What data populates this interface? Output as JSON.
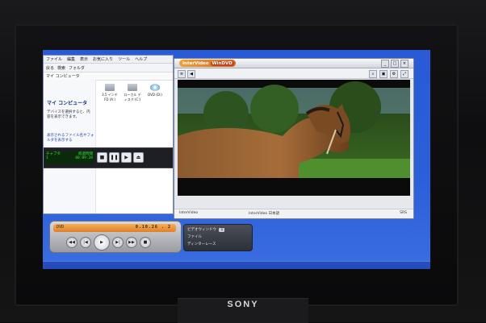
{
  "explorer": {
    "menu": [
      "ファイル",
      "編集",
      "表示",
      "お気に入り",
      "ツール",
      "ヘルプ"
    ],
    "toolbar": [
      "戻る",
      "検索",
      "フォルダ"
    ],
    "address": "マイ コンピュータ",
    "title": "マイ コンピュータ",
    "description": "デバイスを選択すると、内容を表示できます。",
    "link": "表示されるファイル名やフォルダを表示する",
    "drives": [
      {
        "label": "3.5 インチ FD (A:)",
        "kind": "floppy"
      },
      {
        "label": "ローカル ディスク (C:)",
        "kind": "disk"
      },
      {
        "label": "DVD (D:)",
        "kind": "dvd"
      }
    ]
  },
  "status": {
    "lcd_rows": [
      [
        "チャプタ",
        "経過時間"
      ],
      [
        "1",
        "00:09:28"
      ]
    ]
  },
  "windvd": {
    "logo_prefix": "InterVideo",
    "logo_product": "WinDVD",
    "status_left": "InterVideo",
    "status_mid": "InterVideo 日本語",
    "status_right": "SRS"
  },
  "player": {
    "mode": "DVD",
    "time": "0.10.26 . 2"
  },
  "panel": {
    "row1_label": "ビデオウィンドウ",
    "row1_value": "1",
    "row2_label": "ファイル",
    "row3_label": "ディンターレース"
  },
  "tv": {
    "brand": "SONY"
  },
  "colors": {
    "desktop": "#2c5fd9",
    "lcd_text": "#3be23b",
    "player_lcd": "#e07f25"
  }
}
